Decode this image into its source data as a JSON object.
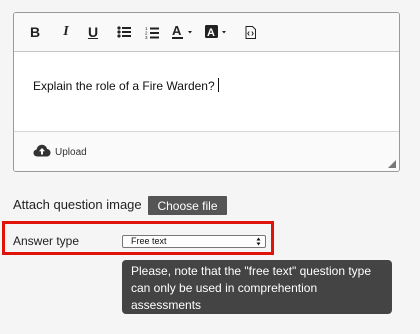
{
  "editor": {
    "toolbar": {
      "bold_label": "B",
      "italic_label": "I",
      "underline_label": "U",
      "font_color_label": "A",
      "bg_color_label": "A",
      "icons": [
        "bold-icon",
        "italic-icon",
        "underline-icon",
        "bulleted-list-icon",
        "numbered-list-icon",
        "font-color-icon",
        "background-color-icon",
        "source-icon"
      ]
    },
    "content": "Explain the role of a Fire Warden?",
    "upload_label": "Upload"
  },
  "attach": {
    "label": "Attach question image",
    "button_label": "Choose file"
  },
  "answer_type": {
    "label": "Answer type",
    "selected": "Free text"
  },
  "tooltip": {
    "text": "Please, note that the \"free text\" question type can only be used in comprehention assessments"
  },
  "colors": {
    "highlight": "#e0130a",
    "tooltip_bg": "#444444",
    "button_bg": "#555555"
  }
}
